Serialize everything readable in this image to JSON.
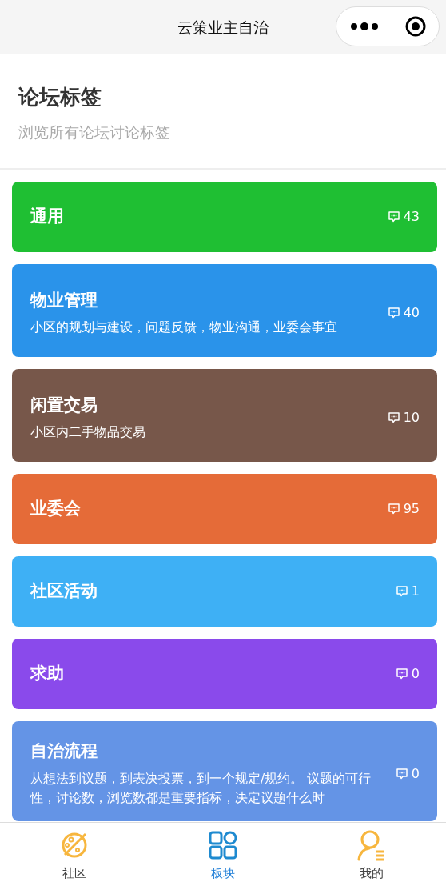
{
  "window": {
    "title": "云策业主自治"
  },
  "header": {
    "title": "论坛标签",
    "subtitle": "浏览所有论坛讨论标签"
  },
  "tags": [
    {
      "name": "通用",
      "count": "43",
      "color": "#1fbf33"
    },
    {
      "name": "物业管理",
      "description": "小区的规划与建设，问题反馈，物业沟通，业委会事宜",
      "count": "40",
      "color": "#2a93ea"
    },
    {
      "name": "闲置交易",
      "description": "小区内二手物品交易",
      "count": "10",
      "color": "#77574a"
    },
    {
      "name": "业委会",
      "count": "95",
      "color": "#e56b38"
    },
    {
      "name": "社区活动",
      "count": "1",
      "color": "#3eb0f5"
    },
    {
      "name": "求助",
      "count": "0",
      "color": "#8a4aeb"
    },
    {
      "name": "自治流程",
      "description": "从想法到议题，到表决投票，到一个规定/规约。 议题的可行性，讨论数，浏览数都是重要指标，决定议题什么时",
      "count": "0",
      "color": "#6494e6"
    }
  ],
  "tabbar": [
    {
      "label": "社区",
      "kind": "planet",
      "selected": false
    },
    {
      "label": "板块",
      "kind": "grid",
      "selected": true
    },
    {
      "label": "我的",
      "kind": "user",
      "selected": false
    }
  ]
}
